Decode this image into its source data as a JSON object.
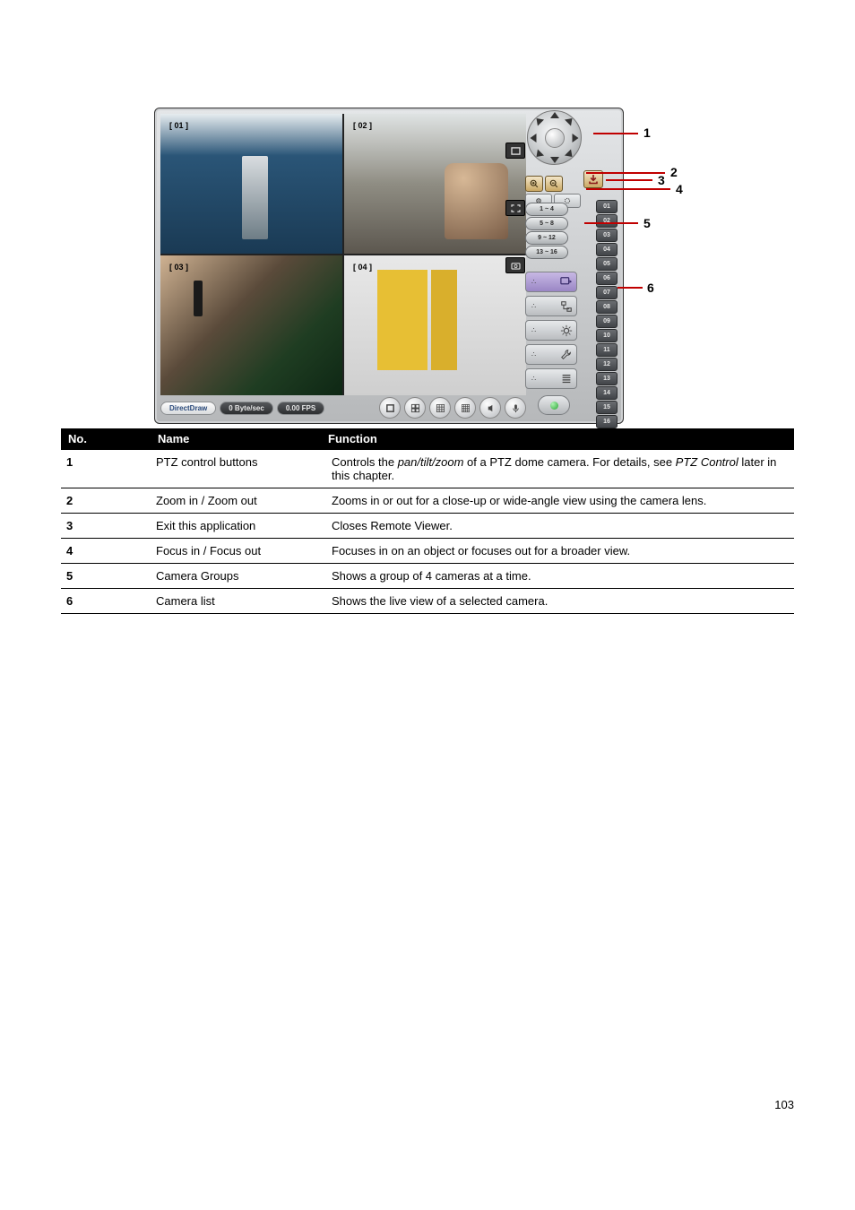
{
  "camera_labels": {
    "c1": "[ 01 ]",
    "c2": "[ 02 ]",
    "c3": "[ 03 ]",
    "c4": "[ 04 ]"
  },
  "status": {
    "draw": "DirectDraw",
    "rate": "0 Byte/sec",
    "fps": "0.00 FPS"
  },
  "groups": {
    "g1": "1 ~ 4",
    "g2": "5 ~ 8",
    "g3": "9 ~ 12",
    "g4": "13 ~ 16"
  },
  "channels": {
    "c1": "01",
    "c2": "02",
    "c3": "03",
    "c4": "04",
    "c5": "05",
    "c6": "06",
    "c7": "07",
    "c8": "08",
    "c9": "09",
    "c10": "10",
    "c11": "11",
    "c12": "12",
    "c13": "13",
    "c14": "14",
    "c15": "15",
    "c16": "16"
  },
  "callout_labels": {
    "l1": "1",
    "l2": "2",
    "l3": "3",
    "l4": "4",
    "l5": "5",
    "l6": "6"
  },
  "legend_header": {
    "no": "No.",
    "name": "Name",
    "function": "Function"
  },
  "rows": {
    "r1": {
      "no": "1",
      "name": "PTZ control buttons",
      "desc_a": "Controls the ",
      "desc_i": "pan/tilt/zoom",
      "desc_b": " of a PTZ dome camera. For details, see ",
      "desc_c": "PTZ Control",
      "desc_d": " later in this chapter."
    },
    "r2": {
      "no": "2",
      "name": "Zoom in / Zoom out",
      "desc": "Zooms in or out for a close-up or wide-angle view using the camera lens."
    },
    "r3": {
      "no": "3",
      "name": "Exit this application",
      "desc": "Closes Remote Viewer."
    },
    "r4": {
      "no": "4",
      "name": "Focus in / Focus out",
      "desc": "Focuses in on an object or focuses out for a broader view."
    },
    "r5": {
      "no": "5",
      "name": "Camera Groups",
      "desc": "Shows a group of 4 cameras at a time."
    },
    "r6": {
      "no": "6",
      "name": "Camera list",
      "desc": "Shows the live view of a selected camera."
    }
  },
  "page_number": "103"
}
